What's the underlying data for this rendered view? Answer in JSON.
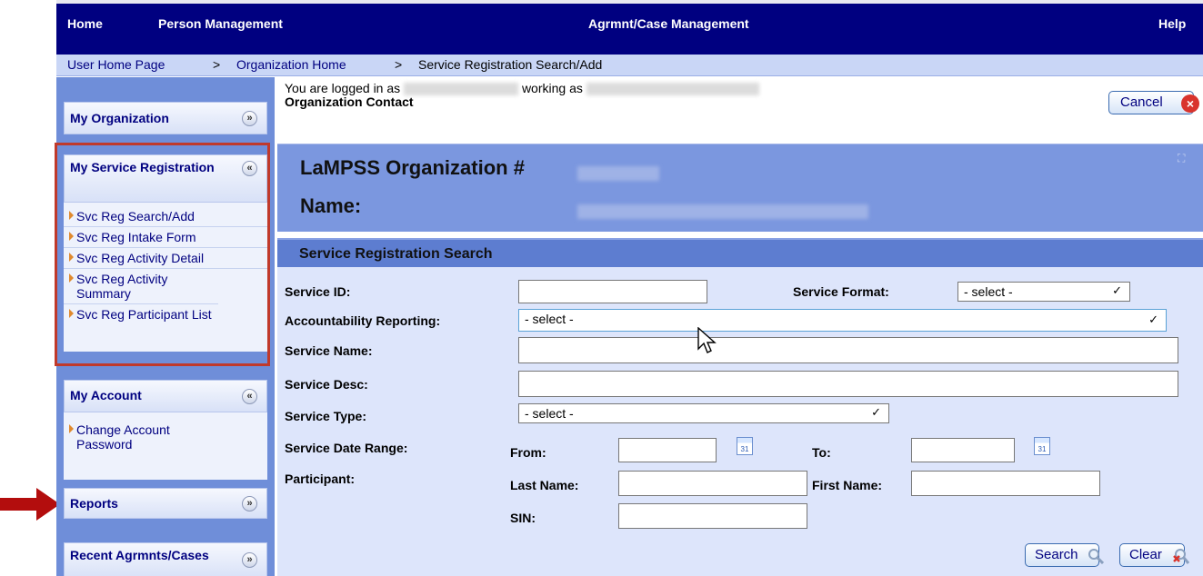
{
  "topnav": {
    "home": "Home",
    "person_management": "Person Management",
    "case_management": "Agrmnt/Case Management",
    "help": "Help"
  },
  "breadcrumb": {
    "home": "User Home Page",
    "sep": ">",
    "org_home": "Organization Home",
    "current": "Service Registration Search/Add"
  },
  "sidebar": {
    "organization": {
      "title": "My Organization"
    },
    "service_registration": {
      "title": "My Service Registration",
      "links": [
        "Svc Reg Search/Add",
        "Svc Reg Intake Form",
        "Svc Reg Activity Detail",
        "Svc Reg Activity Summary",
        "Svc Reg Participant List"
      ]
    },
    "account": {
      "title": "My Account",
      "links": [
        "Change Account Password"
      ]
    },
    "reports": {
      "title": "Reports"
    },
    "recent": {
      "title": "Recent Agrmnts/Cases"
    }
  },
  "session": {
    "logged_in_as": "You are logged in as",
    "working_as": "working as",
    "role": "Organization Contact"
  },
  "cancel_label": "Cancel",
  "org": {
    "number_label": "LaMPSS Organization #",
    "name_label": "Name:"
  },
  "search": {
    "section_title": "Service Registration Search",
    "service_id_label": "Service ID:",
    "service_format_label": "Service Format:",
    "service_format_value": "- select -",
    "accountability_label": "Accountability Reporting:",
    "accountability_value": "- select -",
    "service_name_label": "Service Name:",
    "service_desc_label": "Service Desc:",
    "service_type_label": "Service Type:",
    "service_type_value": "- select -",
    "date_range_label": "Service Date Range:",
    "from_label": "From:",
    "to_label": "To:",
    "participant_label": "Participant:",
    "last_name_label": "Last Name:",
    "first_name_label": "First Name:",
    "sin_label": "SIN:",
    "calendar_day": "31",
    "search_button": "Search",
    "clear_button": "Clear"
  },
  "colors": {
    "topnav_bg": "#000080",
    "sidebar_bg": "#6f8ed9",
    "highlight_box": "#c0392b",
    "annotation_arrow": "#b30d0d"
  }
}
